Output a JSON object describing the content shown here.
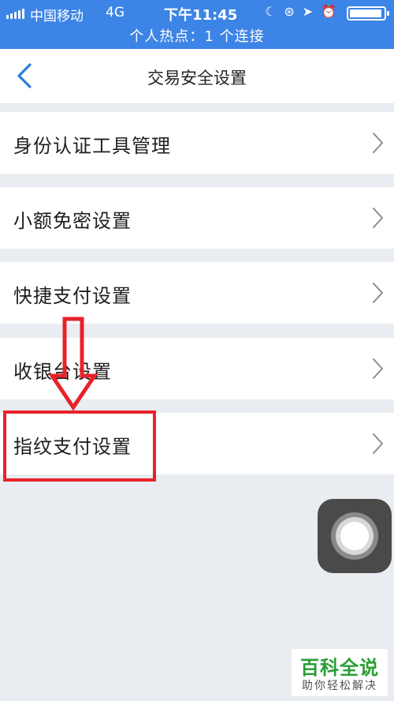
{
  "status_bar": {
    "carrier": "中国移动",
    "network": "4G",
    "time": "下午11:45",
    "hotspot": "个人热点：1 个连接",
    "icons": [
      "moon-icon",
      "rotation-lock-icon",
      "location-icon",
      "alarm-icon",
      "battery-icon"
    ]
  },
  "nav": {
    "back_icon": "chevron-left-icon",
    "title": "交易安全设置"
  },
  "settings": {
    "items": [
      {
        "label": "身份认证工具管理"
      },
      {
        "label": "小额免密设置"
      },
      {
        "label": "快捷支付设置"
      },
      {
        "label": "收银台设置"
      },
      {
        "label": "指纹支付设置"
      }
    ]
  },
  "colors": {
    "status_bar_bg": "#3c84e6",
    "page_bg": "#e9ecf0",
    "accent_blue": "#2d7ce0",
    "annotation_red": "#e8222a"
  },
  "watermark": {
    "title": "百科全说",
    "subtitle": "助你轻松解决"
  }
}
